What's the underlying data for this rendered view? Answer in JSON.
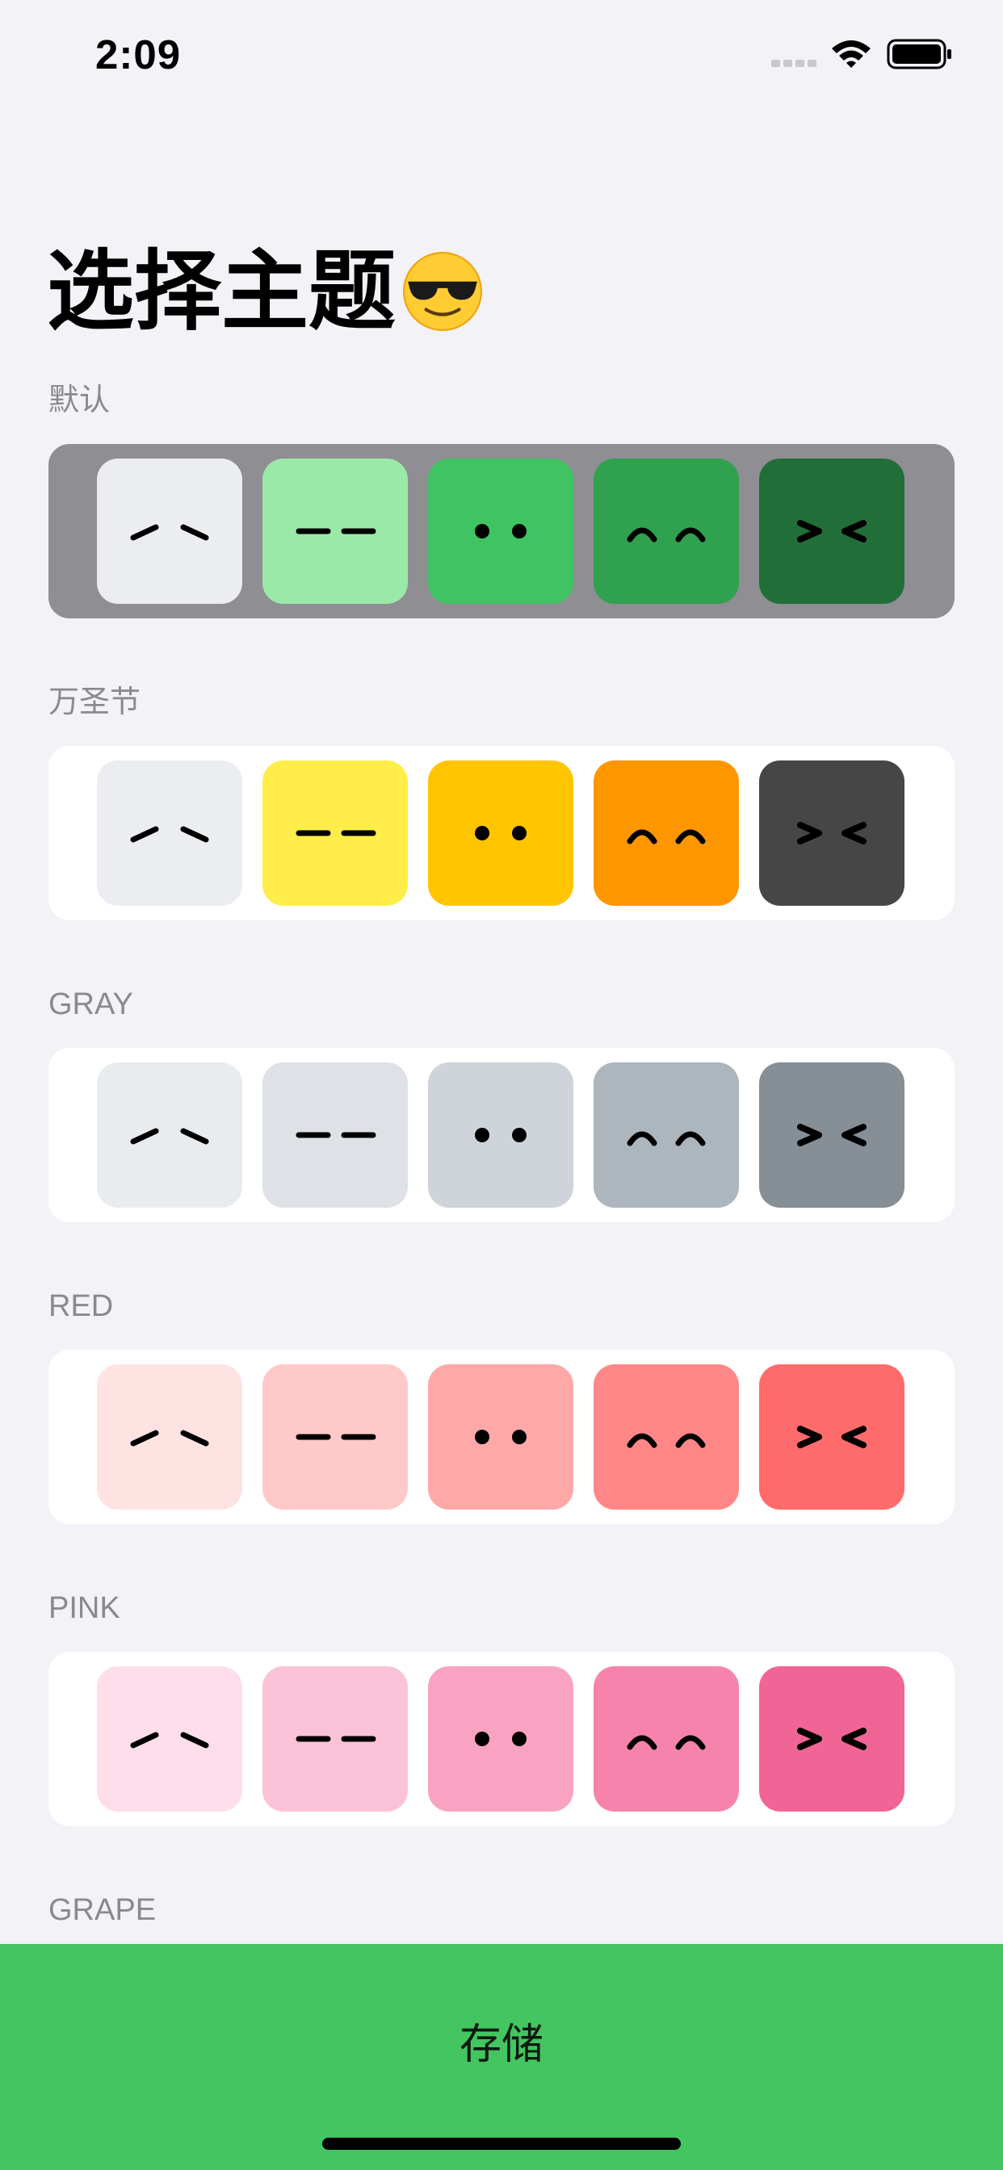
{
  "status_bar": {
    "time": "2:09"
  },
  "title": "选择主题",
  "title_emoji": "smiling-face-with-sunglasses",
  "themes": [
    {
      "label": "默认",
      "selected": true,
      "colors": [
        "#ebedf0",
        "#9be9a8",
        "#40c463",
        "#30a14e",
        "#216e39"
      ]
    },
    {
      "label": "万圣节",
      "selected": false,
      "colors": [
        "#ebedf0",
        "#ffee4a",
        "#ffc501",
        "#fe9600",
        "#464646"
      ]
    },
    {
      "label": "GRAY",
      "selected": false,
      "colors": [
        "#e9ecef",
        "#dee2e6",
        "#ced4da",
        "#adb5bd",
        "#868e96"
      ]
    },
    {
      "label": "RED",
      "selected": false,
      "colors": [
        "#ffe3e3",
        "#ffc9c9",
        "#ffa8a8",
        "#ff8787",
        "#ff6b6b"
      ]
    },
    {
      "label": "PINK",
      "selected": false,
      "colors": [
        "#ffdeeb",
        "#fcc2d7",
        "#faa2c1",
        "#f783ac",
        "#f06595"
      ]
    },
    {
      "label": "GRAPE",
      "selected": false,
      "colors": []
    }
  ],
  "faces": [
    "tilted-eyes",
    "flat-eyes",
    "dot-eyes",
    "happy-arc-eyes",
    "squint-eyes"
  ],
  "save_button": {
    "label": "存储",
    "color": "#43c55f"
  }
}
